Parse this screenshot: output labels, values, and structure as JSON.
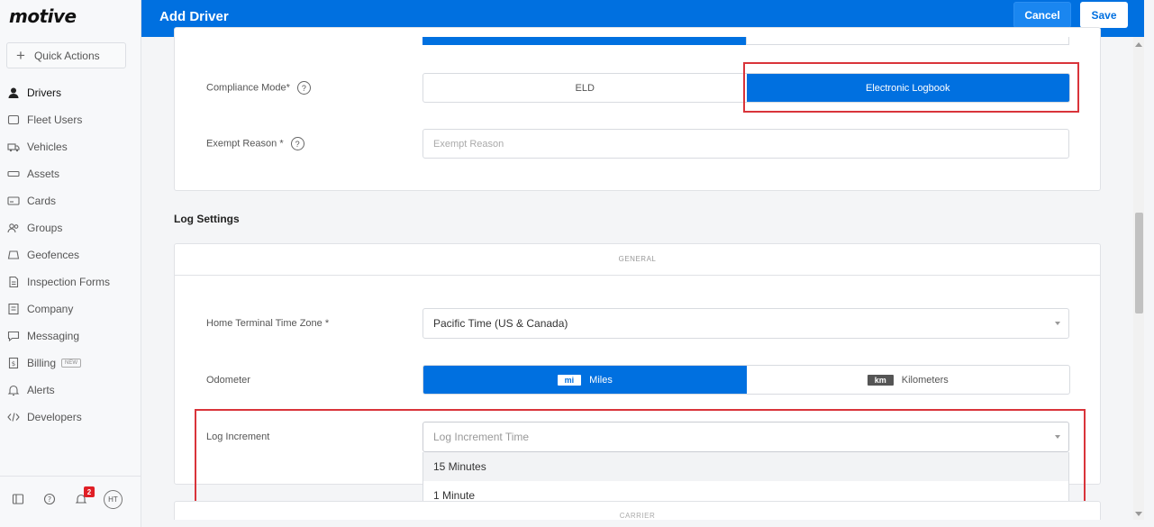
{
  "app": {
    "logo": "motive"
  },
  "sidebar": {
    "quick_actions": "Quick Actions",
    "items": [
      {
        "label": "Drivers",
        "icon": "user-icon",
        "active": true
      },
      {
        "label": "Fleet Users",
        "icon": "chat-square-icon"
      },
      {
        "label": "Vehicles",
        "icon": "truck-icon"
      },
      {
        "label": "Assets",
        "icon": "trailer-icon"
      },
      {
        "label": "Cards",
        "icon": "card-icon"
      },
      {
        "label": "Groups",
        "icon": "group-icon"
      },
      {
        "label": "Geofences",
        "icon": "geofence-icon"
      },
      {
        "label": "Inspection Forms",
        "icon": "document-icon"
      },
      {
        "label": "Company",
        "icon": "building-icon"
      },
      {
        "label": "Messaging",
        "icon": "message-icon"
      },
      {
        "label": "Billing",
        "icon": "billing-icon",
        "badge": "NEW"
      },
      {
        "label": "Alerts",
        "icon": "bell-icon"
      },
      {
        "label": "Developers",
        "icon": "code-icon"
      }
    ],
    "bottom": {
      "notification_count": "2",
      "avatar_initials": "HT"
    }
  },
  "header": {
    "title": "Add Driver",
    "cancel_label": "Cancel",
    "save_label": "Save"
  },
  "compliance": {
    "mode_label": "Compliance Mode*",
    "mode_options": [
      "ELD",
      "Electronic Logbook"
    ],
    "exempt_label": "Exempt Reason *",
    "exempt_placeholder": "Exempt Reason"
  },
  "log_settings": {
    "title": "Log Settings",
    "tab": "GENERAL",
    "time_zone_label": "Home Terminal Time Zone *",
    "time_zone_value": "Pacific Time (US & Canada)",
    "odometer_label": "Odometer",
    "odometer_miles_chip": "mi",
    "odometer_miles": "Miles",
    "odometer_km_chip": "km",
    "odometer_km": "Kilometers",
    "log_increment_label": "Log Increment",
    "log_increment_placeholder": "Log Increment Time",
    "log_increment_options": [
      "15 Minutes",
      "1 Minute"
    ],
    "next_section": "CARRIER"
  },
  "colors": {
    "primary": "#0070e0",
    "highlight_border": "#d9343a"
  }
}
